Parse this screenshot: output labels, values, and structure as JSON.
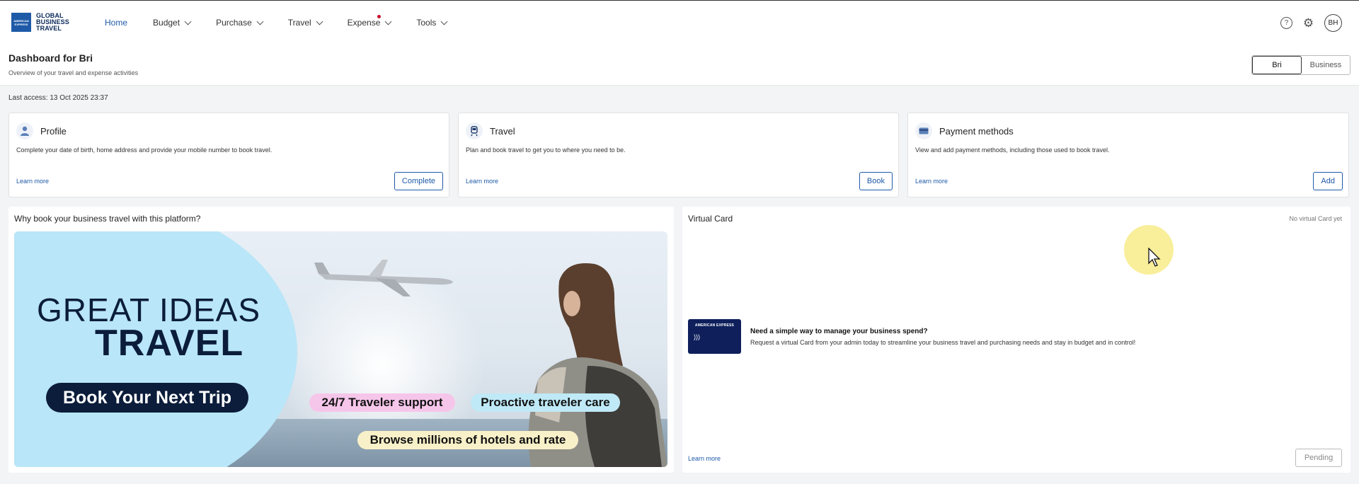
{
  "nav": {
    "logo_lines": [
      "GLOBAL",
      "BUSINESS",
      "TRAVEL"
    ],
    "logo_box_text": "AMERICAN EXPRESS",
    "items": [
      {
        "label": "Home",
        "active": true
      },
      {
        "label": "Budget"
      },
      {
        "label": "Purchase"
      },
      {
        "label": "Travel"
      },
      {
        "label": "Expense",
        "notification": true
      },
      {
        "label": "Tools"
      }
    ],
    "help_icon": "?",
    "settings_icon": "⚙",
    "avatar_initials": "BH"
  },
  "header": {
    "title": "Dashboard for Bri",
    "subtitle": "Overview of your travel and expense activities",
    "toggle": [
      "Bri",
      "Business"
    ]
  },
  "last_access": "Last access: 13 Oct 2025 23:37",
  "cards": [
    {
      "title": "Profile",
      "icon": "user-icon",
      "description": "Complete your date of birth, home address and provide your mobile number to book travel.",
      "learn_more": "Learn more",
      "button": "Complete"
    },
    {
      "title": "Travel",
      "icon": "train-icon",
      "description": "Plan and book travel to get you to where you need to be.",
      "learn_more": "Learn more",
      "button": "Book"
    },
    {
      "title": "Payment methods",
      "icon": "credit-card-icon",
      "description": "View and add payment methods, including those used to book travel.",
      "learn_more": "Learn more",
      "button": "Add"
    }
  ],
  "promo": {
    "title": "Why book your business travel with this platform?",
    "headline_1": "GREAT IDEAS",
    "headline_2": "TRAVEL",
    "cta": "Book Your Next Trip",
    "pill_1": "24/7 Traveler support",
    "pill_2": "Proactive traveler care",
    "pill_3": "Browse millions of hotels and rate"
  },
  "virtual_card": {
    "title": "Virtual Card",
    "status": "No virtual Card yet",
    "card_brand": "AMERICAN EXPRESS",
    "heading": "Need a simple way to manage your business spend?",
    "text": "Request a virtual Card from your admin today to streamline your business travel and purchasing needs and stay in budget and in control!",
    "learn_more": "Learn more",
    "button": "Pending"
  },
  "colors": {
    "accent": "#1e5aa8",
    "navy": "#0b1d3a",
    "card_navy": "#0e1f5c",
    "notification": "#c8102e"
  }
}
